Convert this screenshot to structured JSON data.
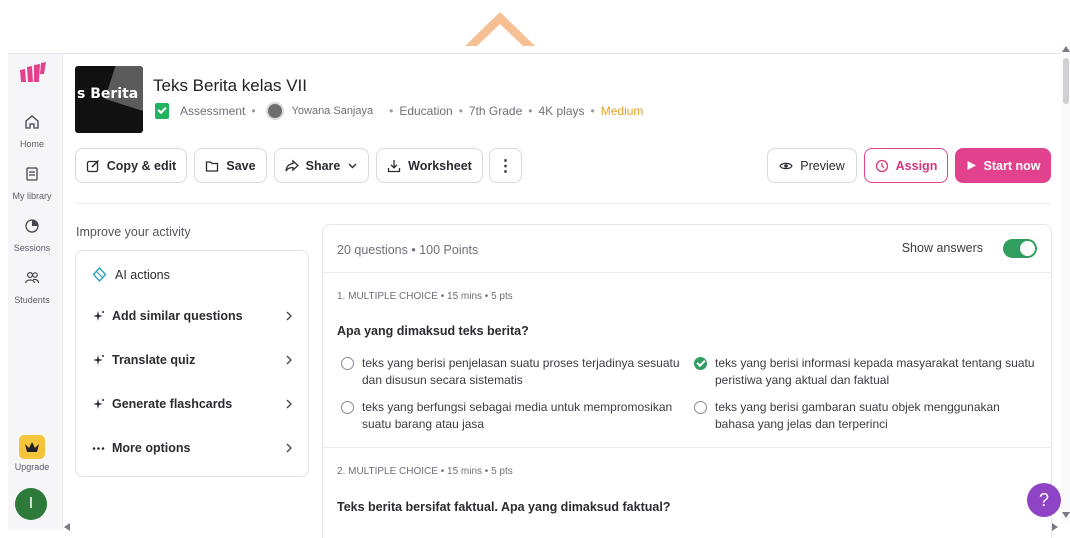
{
  "sidebar": {
    "items": [
      {
        "label": "Home",
        "icon": "home-icon"
      },
      {
        "label": "My library",
        "icon": "library-icon"
      },
      {
        "label": "Sessions",
        "icon": "sessions-icon"
      },
      {
        "label": "Students",
        "icon": "students-icon"
      }
    ],
    "upgrade_label": "Upgrade",
    "avatar_initial": "I"
  },
  "header": {
    "thumbnail_text": "s Berita",
    "title": "Teks Berita kelas VII",
    "type": "Assessment",
    "author": "Yowana Sanjaya",
    "subject": "Education",
    "grade": "7th Grade",
    "plays": "4K plays",
    "difficulty": "Medium"
  },
  "actions": {
    "copy_edit": "Copy & edit",
    "save": "Save",
    "share": "Share",
    "worksheet": "Worksheet",
    "more": "⋮",
    "preview": "Preview",
    "assign": "Assign",
    "start_now": "Start now"
  },
  "improve": {
    "heading": "Improve your activity",
    "ai_actions": "AI actions",
    "rows": [
      {
        "label": "Add similar questions"
      },
      {
        "label": "Translate quiz"
      },
      {
        "label": "Generate flashcards"
      },
      {
        "label": "More options"
      }
    ]
  },
  "quiz": {
    "summary": "20 questions  • 100 Points",
    "show_answers_label": "Show answers",
    "show_answers_on": true,
    "questions": [
      {
        "type_line": "1. MULTIPLE CHOICE  •  15 mins  •  5 pts",
        "text": "Apa yang dimaksud teks berita?",
        "options": [
          {
            "text": "teks yang berisi penjelasan suatu proses terjadinya sesuatu dan disusun secara sistematis",
            "correct": false
          },
          {
            "text": "teks yang berisi informasi kepada masyarakat tentang suatu peristiwa yang aktual dan faktual",
            "correct": true
          },
          {
            "text": "teks yang berfungsi sebagai media untuk mempromosikan suatu barang atau jasa",
            "correct": false
          },
          {
            "text": "teks yang berisi gambaran suatu objek menggunakan bahasa yang jelas dan terperinci",
            "correct": false
          }
        ]
      },
      {
        "type_line": "2. MULTIPLE CHOICE  •  15 mins  •  5 pts",
        "text": "Teks berita bersifat faktual. Apa yang dimaksud faktual?"
      }
    ]
  },
  "help_label": "?",
  "colors": {
    "brand": "#e2428d",
    "correct": "#2f9e5e",
    "difficulty_medium": "#e6a02b",
    "help": "#8e44c4"
  }
}
